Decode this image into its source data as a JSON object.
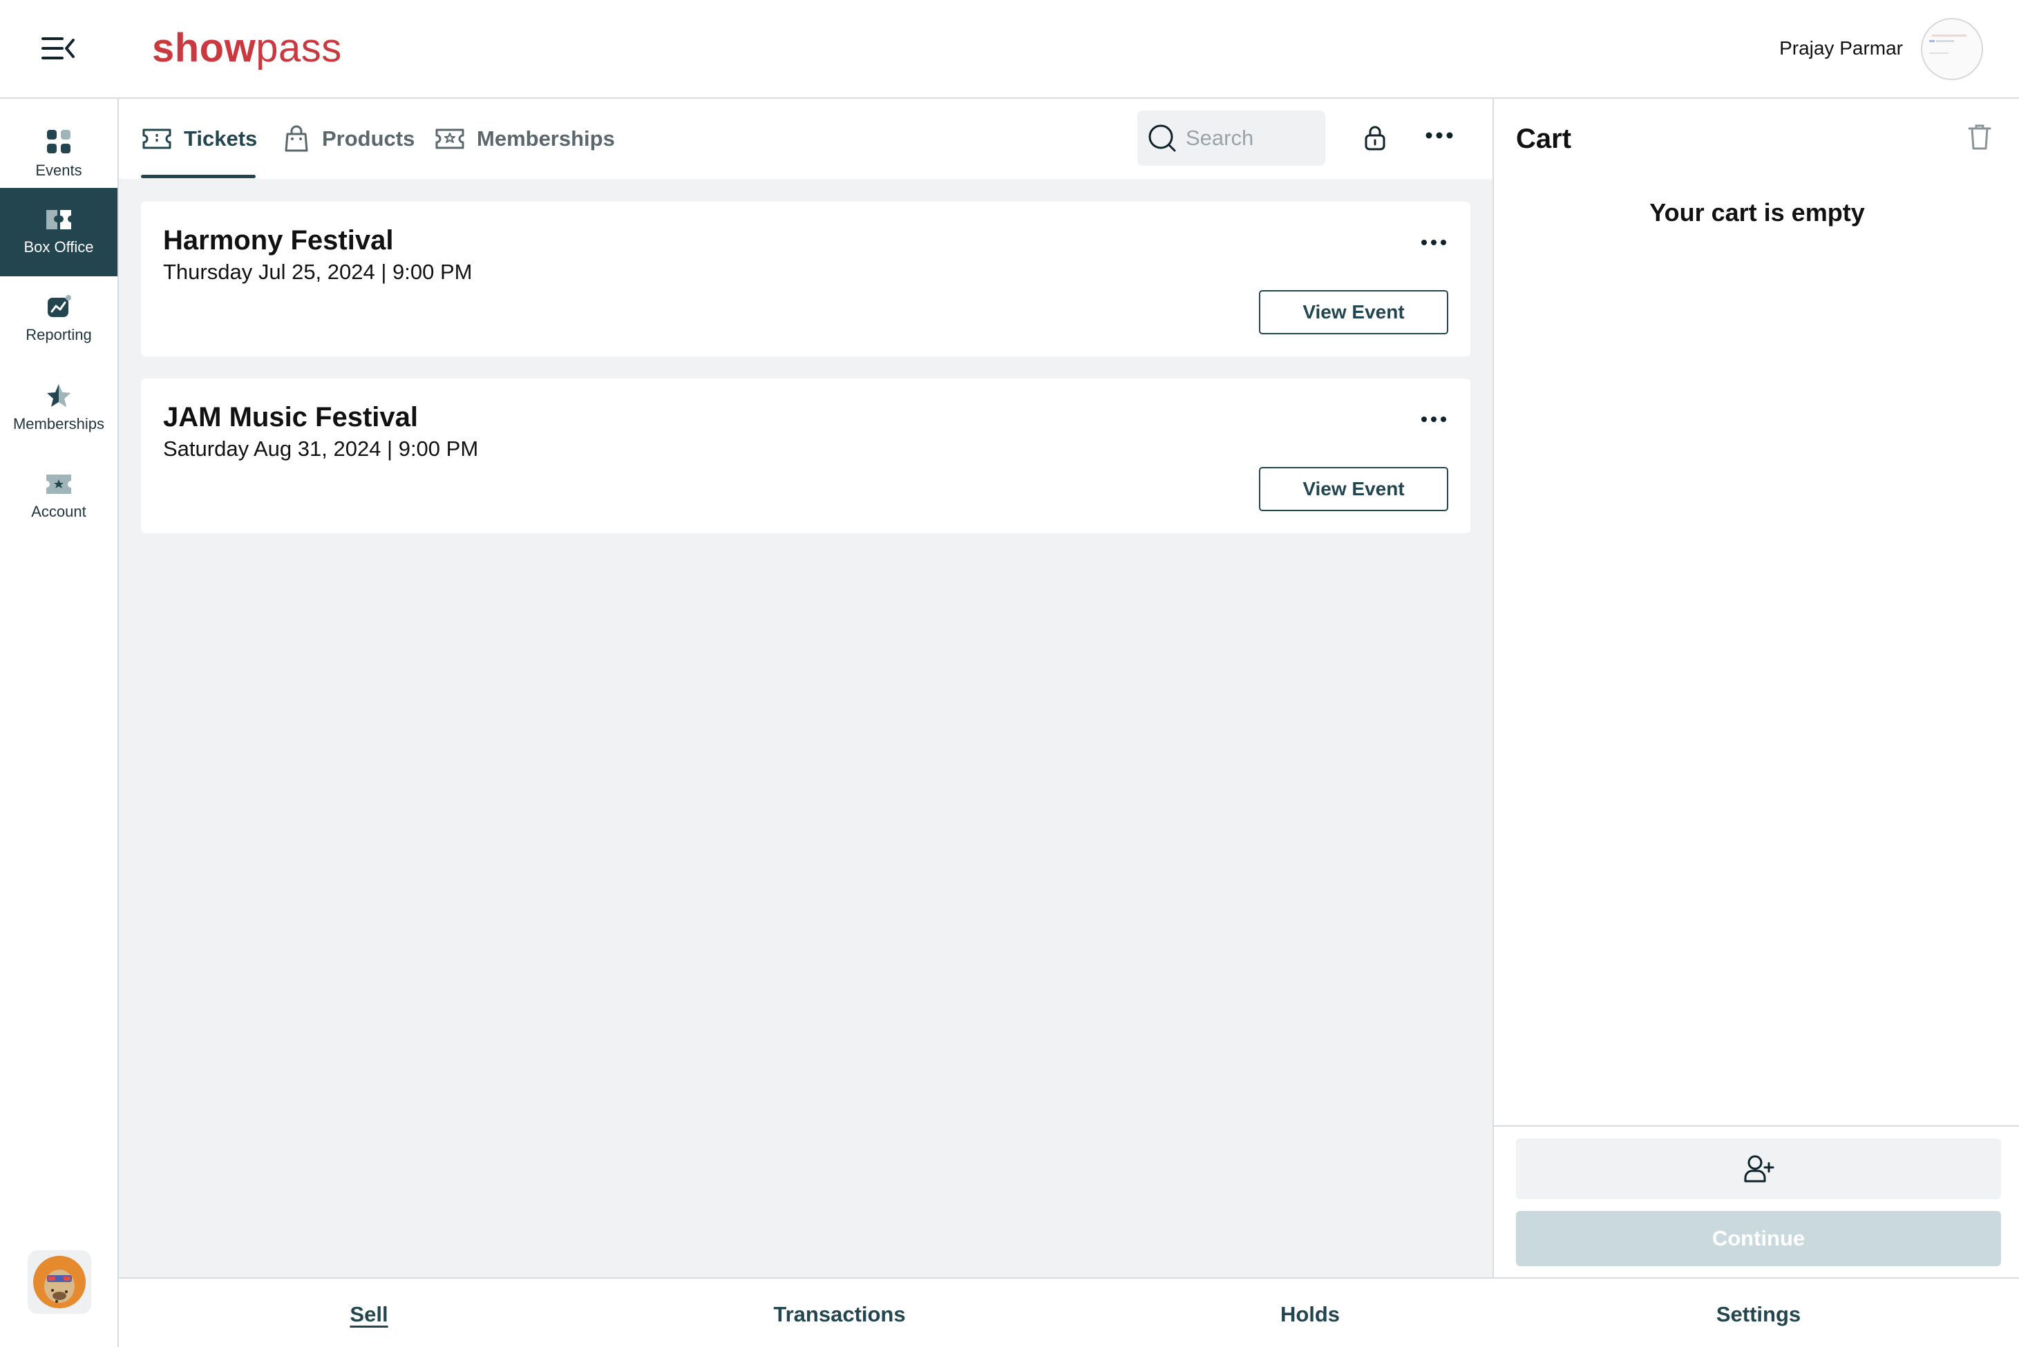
{
  "header": {
    "logo_bold": "show",
    "logo_light": "pass",
    "user_name": "Prajay Parmar"
  },
  "sidebar": {
    "items": [
      {
        "label": "Events",
        "icon": "grid-icon"
      },
      {
        "label": "Box Office",
        "icon": "ticket-icon",
        "active": true
      },
      {
        "label": "Reporting",
        "icon": "chart-icon"
      },
      {
        "label": "Memberships",
        "icon": "star-badge-icon"
      },
      {
        "label": "Account",
        "icon": "account-ticket-icon"
      }
    ]
  },
  "tabs": {
    "items": [
      {
        "label": "Tickets",
        "icon": "ticket-outline-icon",
        "active": true
      },
      {
        "label": "Products",
        "icon": "shopping-bag-icon"
      },
      {
        "label": "Memberships",
        "icon": "membership-ticket-icon"
      }
    ],
    "search_placeholder": "Search"
  },
  "events": [
    {
      "title": "Harmony Festival",
      "date": "Thursday Jul 25, 2024 | 9:00 PM",
      "button": "View Event"
    },
    {
      "title": "JAM Music Festival",
      "date": "Saturday Aug 31, 2024 | 9:00 PM",
      "button": "View Event"
    }
  ],
  "cart": {
    "title": "Cart",
    "empty_message": "Your cart is empty",
    "continue_label": "Continue"
  },
  "bottom_nav": {
    "items": [
      {
        "label": "Sell",
        "active": true
      },
      {
        "label": "Transactions"
      },
      {
        "label": "Holds"
      },
      {
        "label": "Settings"
      }
    ]
  },
  "colors": {
    "brand": "#c9393f",
    "primary": "#23454f",
    "background": "#f0f2f3",
    "continue_disabled": "#c9d9dd"
  }
}
